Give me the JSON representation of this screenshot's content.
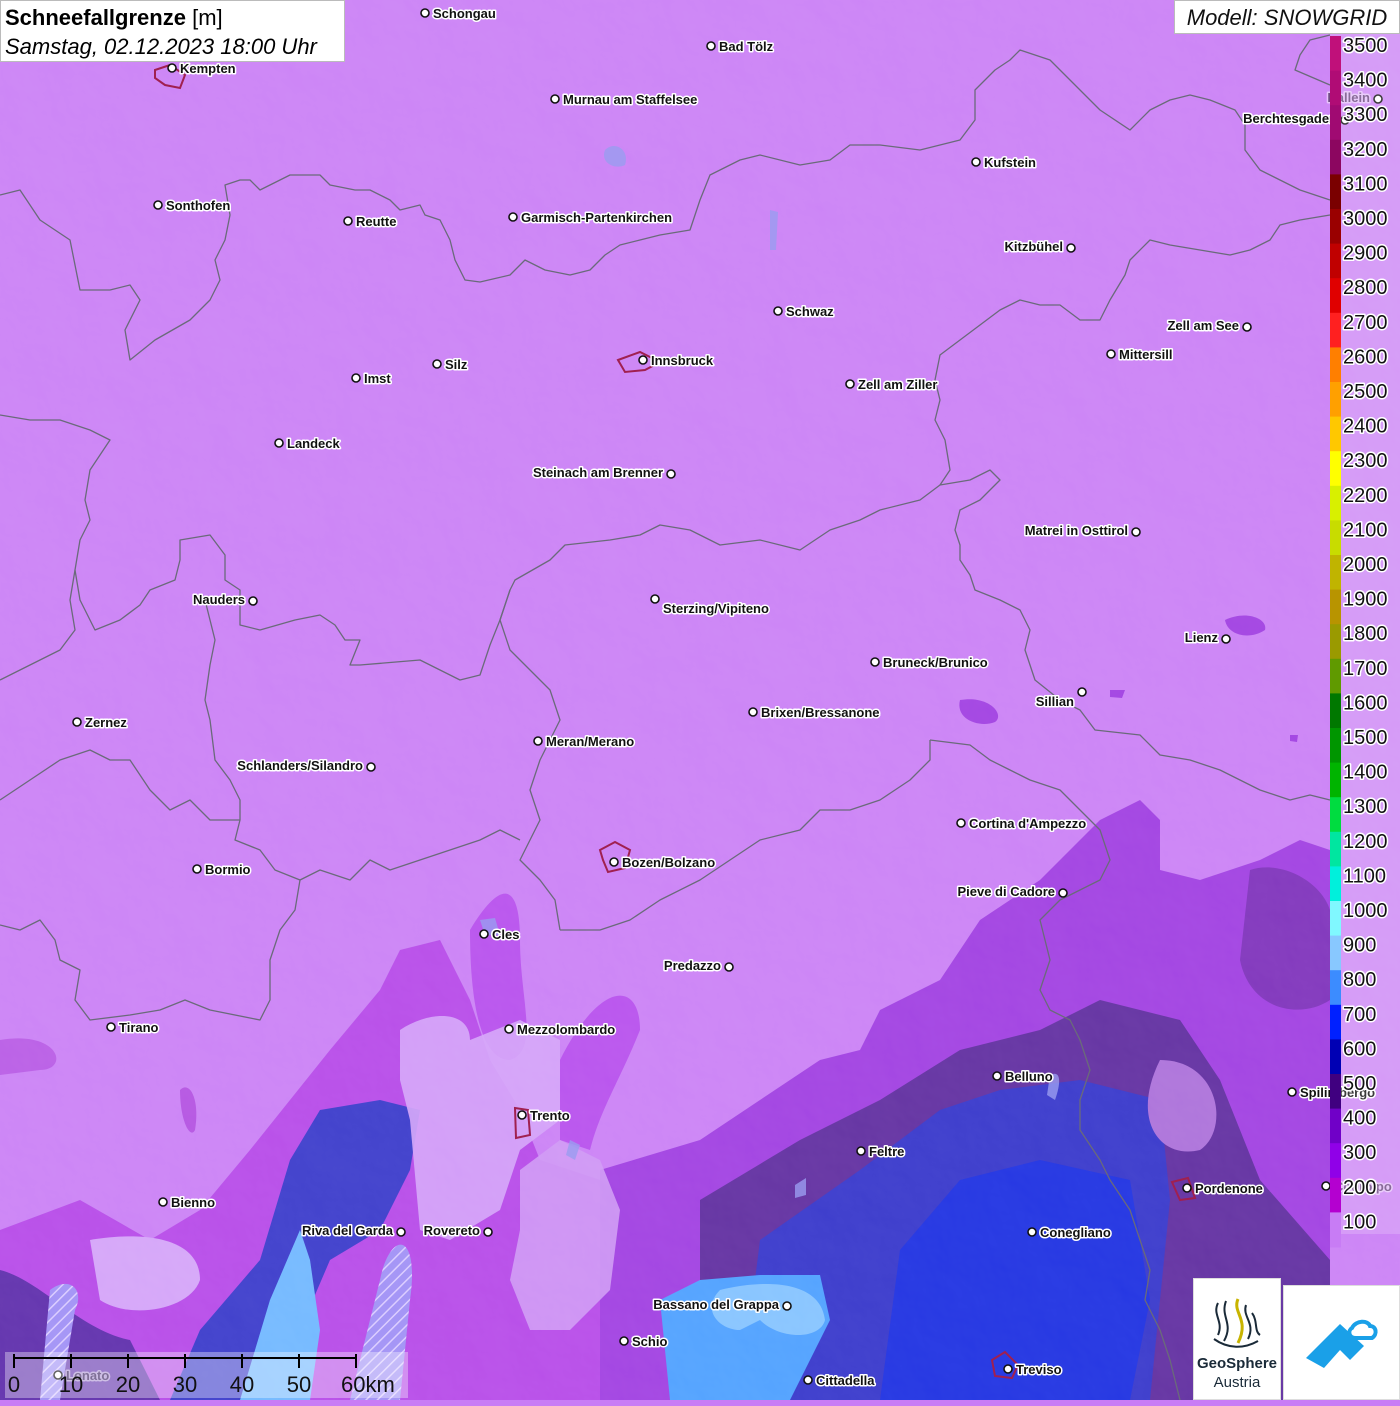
{
  "title": {
    "main": "Schneefallgrenze",
    "unit": "[m]",
    "time": "Samstag, 02.12.2023 18:00 Uhr"
  },
  "model": "Modell: SNOWGRID",
  "legend": {
    "levels": [
      {
        "label": "3500",
        "color": "#c0107a"
      },
      {
        "label": "3400",
        "color": "#b00c75"
      },
      {
        "label": "3300",
        "color": "#a00a72"
      },
      {
        "label": "3200",
        "color": "#8c0660"
      },
      {
        "label": "3100",
        "color": "#7a0000"
      },
      {
        "label": "3000",
        "color": "#9a0000"
      },
      {
        "label": "2900",
        "color": "#c00000"
      },
      {
        "label": "2800",
        "color": "#e00000"
      },
      {
        "label": "2700",
        "color": "#ff2020"
      },
      {
        "label": "2600",
        "color": "#ff7f00"
      },
      {
        "label": "2500",
        "color": "#ffa000"
      },
      {
        "label": "2400",
        "color": "#ffc800"
      },
      {
        "label": "2300",
        "color": "#ffff00"
      },
      {
        "label": "2200",
        "color": "#d8f000"
      },
      {
        "label": "2100",
        "color": "#c8dc00"
      },
      {
        "label": "2000",
        "color": "#c0b400"
      },
      {
        "label": "1900",
        "color": "#b89400"
      },
      {
        "label": "1800",
        "color": "#9a9a00"
      },
      {
        "label": "1700",
        "color": "#609a00"
      },
      {
        "label": "1600",
        "color": "#007800"
      },
      {
        "label": "1500",
        "color": "#009600"
      },
      {
        "label": "1400",
        "color": "#00b400"
      },
      {
        "label": "1300",
        "color": "#00dc40"
      },
      {
        "label": "1200",
        "color": "#00e6a0"
      },
      {
        "label": "1100",
        "color": "#00f0dc"
      },
      {
        "label": "1000",
        "color": "#80f8ff"
      },
      {
        "label": "900",
        "color": "#88c8ff"
      },
      {
        "label": "800",
        "color": "#3c8cff"
      },
      {
        "label": "700",
        "color": "#0020ff"
      },
      {
        "label": "600",
        "color": "#0000b4"
      },
      {
        "label": "500",
        "color": "#400080"
      },
      {
        "label": "400",
        "color": "#7000c8"
      },
      {
        "label": "300",
        "color": "#9000e8"
      },
      {
        "label": "200",
        "color": "#b400d0"
      },
      {
        "label": "100",
        "color": "#c87cf5"
      }
    ]
  },
  "cities": [
    {
      "name": "Schongau"
    },
    {
      "name": "Bad Tölz"
    },
    {
      "name": "Kempten"
    },
    {
      "name": "Murnau am Staffelsee"
    },
    {
      "name": "Berchtesgaden"
    },
    {
      "name": "Kufstein"
    },
    {
      "name": "Sonthofen"
    },
    {
      "name": "Reutte"
    },
    {
      "name": "Garmisch-Partenkirchen"
    },
    {
      "name": "Kitzbühel"
    },
    {
      "name": "Schwaz"
    },
    {
      "name": "Zell am See"
    },
    {
      "name": "Mittersill"
    },
    {
      "name": "Innsbruck"
    },
    {
      "name": "Silz"
    },
    {
      "name": "Imst"
    },
    {
      "name": "Zell am Ziller"
    },
    {
      "name": "Landeck"
    },
    {
      "name": "Steinach am Brenner"
    },
    {
      "name": "Matrei in Osttirol"
    },
    {
      "name": "Nauders"
    },
    {
      "name": "Sterzing/Vipiteno"
    },
    {
      "name": "Lienz"
    },
    {
      "name": "Bruneck/Brunico"
    },
    {
      "name": "Sillian"
    },
    {
      "name": "Zernez"
    },
    {
      "name": "Brixen/Bressanone"
    },
    {
      "name": "Meran/Merano"
    },
    {
      "name": "Schlanders/Silandro"
    },
    {
      "name": "Cortina d'Ampezzo"
    },
    {
      "name": "Bormio"
    },
    {
      "name": "Bozen/Bolzano"
    },
    {
      "name": "Pieve di Cadore"
    },
    {
      "name": "Cles"
    },
    {
      "name": "Predazzo"
    },
    {
      "name": "Tirano"
    },
    {
      "name": "Mezzolombardo"
    },
    {
      "name": "Belluno"
    },
    {
      "name": "Spilimbergo"
    },
    {
      "name": "Trento"
    },
    {
      "name": "Feltre"
    },
    {
      "name": "Pordenone"
    },
    {
      "name": "Bienno"
    },
    {
      "name": "Riva del Garda"
    },
    {
      "name": "Rovereto"
    },
    {
      "name": "Conegliano"
    },
    {
      "name": "Bassano del Grappa"
    },
    {
      "name": "Schio"
    },
    {
      "name": "Treviso"
    },
    {
      "name": "Cittadella"
    },
    {
      "name": "Hallein"
    },
    {
      "name": "Codroipo"
    },
    {
      "name": "Lonato"
    }
  ],
  "scale": {
    "ticks": [
      "0",
      "10",
      "20",
      "30",
      "40",
      "50",
      "60km"
    ]
  },
  "logos": {
    "geosphere_line1": "GeoSphere",
    "geosphere_line2": "Austria"
  }
}
